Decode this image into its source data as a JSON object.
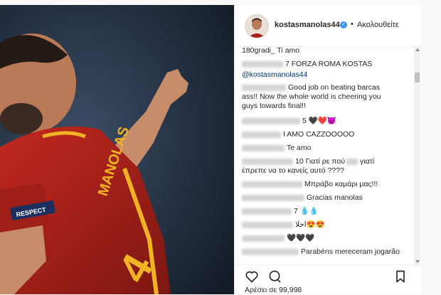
{
  "header": {
    "username": "kostasmanolas44",
    "verified_icon": "verified-badge-icon",
    "separator": "•",
    "follow_label": "Ακολουθείτε"
  },
  "comments": [
    {
      "user": "",
      "text": "180gradi_ Ti amo"
    },
    {
      "user": "",
      "text": "7 FORZA ROMA KOSTAS"
    },
    {
      "user": "",
      "text": "@kostasmanolas44"
    },
    {
      "user": "",
      "text": "Good job on beating barcas"
    },
    {
      "user": "",
      "text": "ass!! Now the whole world is cheering you"
    },
    {
      "user": "",
      "text": "guys towards final!!"
    },
    {
      "user": "",
      "text": "5 🖤❤️😈"
    },
    {
      "user": "",
      "text": "I AMO CAZZOOOOO"
    },
    {
      "user": "",
      "text": "Te amo"
    },
    {
      "user": "",
      "text": "10 Γιατί ρε πού"
    },
    {
      "user": "",
      "text": "γιατί"
    },
    {
      "user": "",
      "text": "έπρεπε να το κανείς αυτό ????"
    },
    {
      "user": "",
      "text": "Μπράβο καμάρι μας!!!"
    },
    {
      "user": "",
      "text": "Gracias manolas"
    },
    {
      "user": "",
      "text": "7 💧💧"
    },
    {
      "user": "",
      "text": "احلا😍😍"
    },
    {
      "user": "",
      "text": "🖤🖤🖤"
    },
    {
      "user": "",
      "text": "Parabéns mereceram jogarão"
    }
  ],
  "actions": {
    "like_icon": "heart-icon",
    "comment_icon": "comment-icon",
    "save_icon": "bookmark-icon",
    "likes_text": "Αρέσει σε 99,998"
  },
  "photo": {
    "jersey_text": "MANOLAS",
    "patch_text": "RESPECT"
  },
  "colors": {
    "link": "#003569",
    "verified": "#3897f0",
    "jersey": "#a8201a",
    "trim": "#f0b323"
  }
}
